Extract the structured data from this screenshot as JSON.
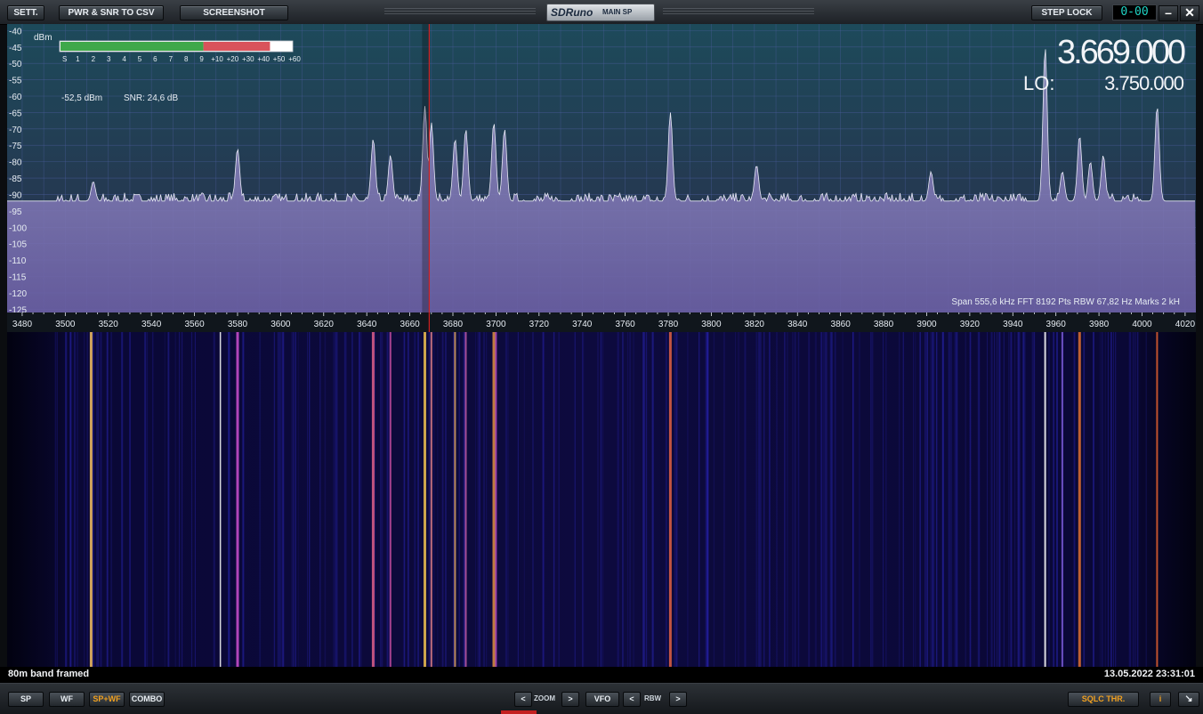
{
  "toolbar": {
    "settings_label": "SETT.",
    "pwr_snr_label": "PWR & SNR TO CSV",
    "screenshot_label": "SCREENSHOT",
    "brand_logo": "SDRuno",
    "brand_sub": "MAIN SP",
    "step_lock_label": "STEP LOCK",
    "clock": "0-00",
    "minimize_glyph": "–",
    "close_glyph": "✕"
  },
  "meter": {
    "unit": "dBm",
    "scale": [
      "S",
      "1",
      "2",
      "3",
      "4",
      "5",
      "6",
      "7",
      "8",
      "9",
      "+10",
      "+20",
      "+30",
      "+40",
      "+50",
      "+60"
    ],
    "level_s_units": 9,
    "power_reading": "-52,5 dBm",
    "snr_reading": "SNR: 24,6 dB"
  },
  "frequency": {
    "vfo": "3.669.000",
    "lo_label": "LO:",
    "lo": "3.750.000"
  },
  "spectrum_info": "Span 555,6 kHz   FFT 8192 Pts   RBW 67,82 Hz   Marks 2 kH",
  "chart_data": {
    "type": "area",
    "xlabel": "",
    "ylabel": "dBm",
    "xlim": [
      3473,
      4025
    ],
    "ylim": [
      -126,
      -38
    ],
    "y_ticks": [
      -40,
      -45,
      -50,
      -55,
      -60,
      -65,
      -70,
      -75,
      -80,
      -85,
      -90,
      -95,
      -100,
      -105,
      -110,
      -115,
      -120,
      -125
    ],
    "x_ticks": [
      3480,
      3500,
      3520,
      3540,
      3560,
      3580,
      3600,
      3620,
      3640,
      3660,
      3680,
      3700,
      3720,
      3740,
      3760,
      3780,
      3800,
      3820,
      3840,
      3860,
      3880,
      3900,
      3920,
      3940,
      3960,
      3980,
      4000,
      4020
    ],
    "tuned_frequency_khz": 3669,
    "grid": true,
    "peaks": [
      {
        "x": 3580,
        "y": -76
      },
      {
        "x": 3643,
        "y": -73
      },
      {
        "x": 3651,
        "y": -78
      },
      {
        "x": 3667,
        "y": -63
      },
      {
        "x": 3670,
        "y": -68
      },
      {
        "x": 3681,
        "y": -73
      },
      {
        "x": 3686,
        "y": -70
      },
      {
        "x": 3699,
        "y": -68
      },
      {
        "x": 3704,
        "y": -70
      },
      {
        "x": 3781,
        "y": -65
      },
      {
        "x": 3821,
        "y": -81
      },
      {
        "x": 3955,
        "y": -45
      },
      {
        "x": 3963,
        "y": -83
      },
      {
        "x": 3971,
        "y": -72
      },
      {
        "x": 3976,
        "y": -80
      },
      {
        "x": 3982,
        "y": -78
      },
      {
        "x": 4007,
        "y": -63
      },
      {
        "x": 3513,
        "y": -86
      },
      {
        "x": 3902,
        "y": -83
      }
    ],
    "noise_floor_dbm": -92
  },
  "waterfall": {
    "band_label": "80m band framed",
    "timestamp": "13.05.2022 23:31:01"
  },
  "bottom": {
    "sp_label": "SP",
    "wf_label": "WF",
    "spwf_label": "SP+WF",
    "combo_label": "COMBO",
    "zoom_label": "ZOOM",
    "vfo_label": "VFO",
    "rbw_label": "RBW",
    "left_arrow": "<",
    "right_arrow": ">",
    "sqlc_label": "SQLC THR.",
    "info_label": "i",
    "resize_glyph": "↘"
  },
  "colors": {
    "accent_orange": "#f0a020",
    "trace": "#e6e8f4",
    "fill": "#8a86b8",
    "tuned_marker": "#d02020"
  }
}
